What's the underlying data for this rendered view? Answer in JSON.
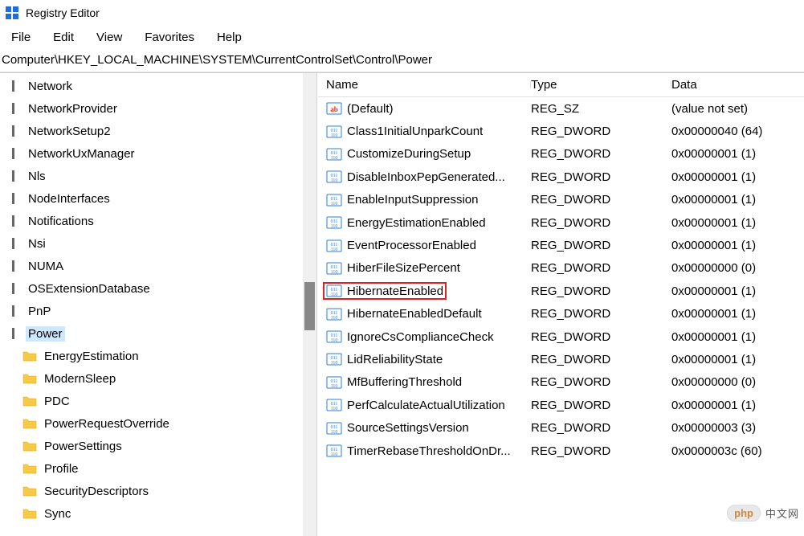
{
  "titlebar": {
    "app_title": "Registry Editor"
  },
  "menubar": {
    "file": "File",
    "edit": "Edit",
    "view": "View",
    "favorites": "Favorites",
    "help": "Help"
  },
  "addressbar": {
    "path": "Computer\\HKEY_LOCAL_MACHINE\\SYSTEM\\CurrentControlSet\\Control\\Power"
  },
  "tree": {
    "items": [
      {
        "label": "Network",
        "level": 0,
        "kind": "key"
      },
      {
        "label": "NetworkProvider",
        "level": 0,
        "kind": "key"
      },
      {
        "label": "NetworkSetup2",
        "level": 0,
        "kind": "key"
      },
      {
        "label": "NetworkUxManager",
        "level": 0,
        "kind": "key"
      },
      {
        "label": "Nls",
        "level": 0,
        "kind": "key"
      },
      {
        "label": "NodeInterfaces",
        "level": 0,
        "kind": "key"
      },
      {
        "label": "Notifications",
        "level": 0,
        "kind": "key"
      },
      {
        "label": "Nsi",
        "level": 0,
        "kind": "key"
      },
      {
        "label": "NUMA",
        "level": 0,
        "kind": "key"
      },
      {
        "label": "OSExtensionDatabase",
        "level": 0,
        "kind": "key"
      },
      {
        "label": "PnP",
        "level": 0,
        "kind": "key"
      },
      {
        "label": "Power",
        "level": 0,
        "kind": "key",
        "selected": true
      },
      {
        "label": "EnergyEstimation",
        "level": 1,
        "kind": "folder"
      },
      {
        "label": "ModernSleep",
        "level": 1,
        "kind": "folder"
      },
      {
        "label": "PDC",
        "level": 1,
        "kind": "folder"
      },
      {
        "label": "PowerRequestOverride",
        "level": 1,
        "kind": "folder"
      },
      {
        "label": "PowerSettings",
        "level": 1,
        "kind": "folder"
      },
      {
        "label": "Profile",
        "level": 1,
        "kind": "folder"
      },
      {
        "label": "SecurityDescriptors",
        "level": 1,
        "kind": "folder"
      },
      {
        "label": "Sync",
        "level": 1,
        "kind": "folder"
      }
    ]
  },
  "values": {
    "header": {
      "name": "Name",
      "type": "Type",
      "data": "Data"
    },
    "rows": [
      {
        "icon": "str",
        "name": "(Default)",
        "type": "REG_SZ",
        "data": "(value not set)"
      },
      {
        "icon": "bin",
        "name": "Class1InitialUnparkCount",
        "type": "REG_DWORD",
        "data": "0x00000040 (64)"
      },
      {
        "icon": "bin",
        "name": "CustomizeDuringSetup",
        "type": "REG_DWORD",
        "data": "0x00000001 (1)"
      },
      {
        "icon": "bin",
        "name": "DisableInboxPepGenerated...",
        "type": "REG_DWORD",
        "data": "0x00000001 (1)"
      },
      {
        "icon": "bin",
        "name": "EnableInputSuppression",
        "type": "REG_DWORD",
        "data": "0x00000001 (1)"
      },
      {
        "icon": "bin",
        "name": "EnergyEstimationEnabled",
        "type": "REG_DWORD",
        "data": "0x00000001 (1)"
      },
      {
        "icon": "bin",
        "name": "EventProcessorEnabled",
        "type": "REG_DWORD",
        "data": "0x00000001 (1)"
      },
      {
        "icon": "bin",
        "name": "HiberFileSizePercent",
        "type": "REG_DWORD",
        "data": "0x00000000 (0)"
      },
      {
        "icon": "bin",
        "name": "HibernateEnabled",
        "type": "REG_DWORD",
        "data": "0x00000001 (1)",
        "highlighted": true
      },
      {
        "icon": "bin",
        "name": "HibernateEnabledDefault",
        "type": "REG_DWORD",
        "data": "0x00000001 (1)"
      },
      {
        "icon": "bin",
        "name": "IgnoreCsComplianceCheck",
        "type": "REG_DWORD",
        "data": "0x00000001 (1)"
      },
      {
        "icon": "bin",
        "name": "LidReliabilityState",
        "type": "REG_DWORD",
        "data": "0x00000001 (1)"
      },
      {
        "icon": "bin",
        "name": "MfBufferingThreshold",
        "type": "REG_DWORD",
        "data": "0x00000000 (0)"
      },
      {
        "icon": "bin",
        "name": "PerfCalculateActualUtilization",
        "type": "REG_DWORD",
        "data": "0x00000001 (1)"
      },
      {
        "icon": "bin",
        "name": "SourceSettingsVersion",
        "type": "REG_DWORD",
        "data": "0x00000003 (3)"
      },
      {
        "icon": "bin",
        "name": "TimerRebaseThresholdOnDr...",
        "type": "REG_DWORD",
        "data": "0x0000003c (60)"
      }
    ]
  },
  "watermark": {
    "php": "php",
    "zh": "中文网"
  }
}
